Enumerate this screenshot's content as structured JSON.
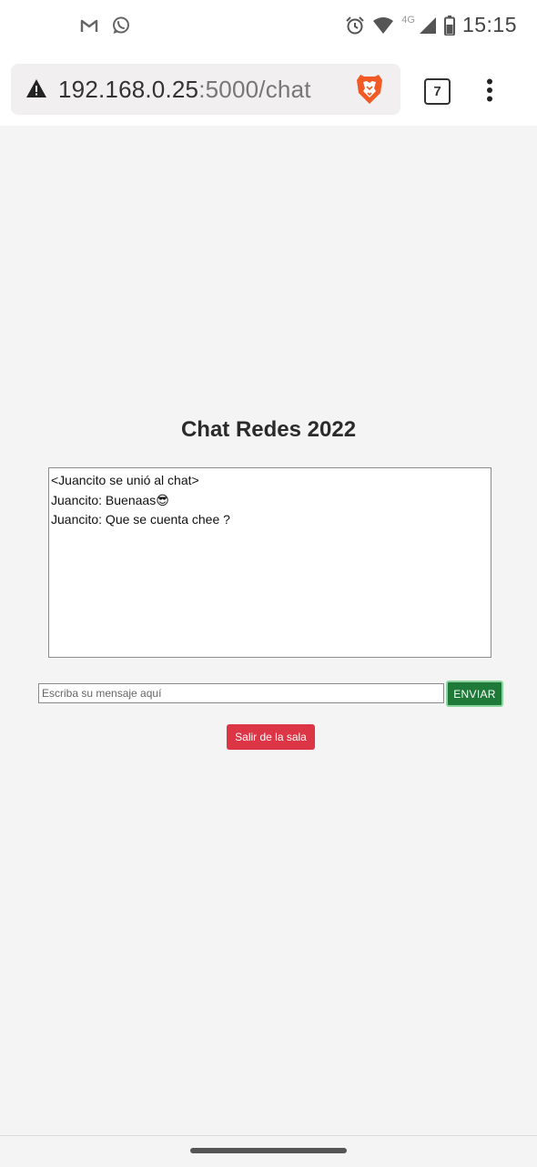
{
  "status_bar": {
    "time": "15:15",
    "network_label": "4G",
    "left_icons": [
      "gmail-icon",
      "whatsapp-icon"
    ],
    "right_icons": [
      "alarm-icon",
      "wifi-icon",
      "signal-icon",
      "battery-icon"
    ]
  },
  "browser": {
    "url_host": "192.168.0.25",
    "url_rest": ":5000/chat",
    "tab_count": "7",
    "icons": [
      "warning-icon",
      "brave-lion-icon",
      "menu-dots-icon"
    ]
  },
  "page": {
    "title": "Chat Redes 2022",
    "messages": [
      "<Juancito se unió al chat>",
      "Juancito: Buenaas😎",
      "Juancito: Que se cuenta chee ?"
    ],
    "input_placeholder": "Escriba su mensaje aquí",
    "send_label": "ENVIAR",
    "leave_label": "Salir de la sala"
  },
  "colors": {
    "page_background": "#f4f4f4",
    "send_button": "#1f7a3a",
    "leave_button": "#dc3545"
  }
}
